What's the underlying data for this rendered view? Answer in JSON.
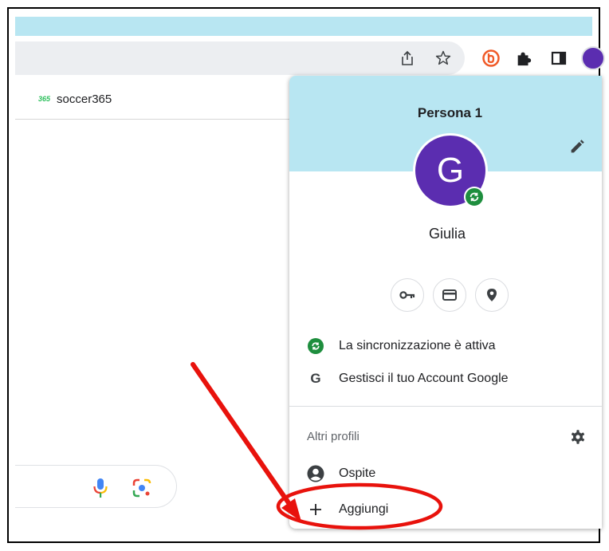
{
  "bookmarks": {
    "items": [
      {
        "label": "soccer365",
        "favicon_text": "365"
      }
    ]
  },
  "profile_menu": {
    "title": "Persona 1",
    "avatar_letter": "G",
    "name": "Giulia",
    "sync_label": "La sincronizzazione è attiva",
    "manage_account_label": "Gestisci il tuo Account Google",
    "other_profiles_label": "Altri profili",
    "guest_label": "Ospite",
    "add_label": "Aggiungi"
  },
  "icons": {
    "toolbar": [
      "share-icon",
      "bookmark-star-icon",
      "extension-b-icon",
      "extensions-puzzle-icon",
      "side-panel-icon",
      "profile-avatar-icon"
    ],
    "quick_actions": [
      "passwords-key-icon",
      "payment-card-icon",
      "addresses-pin-icon"
    ]
  },
  "colors": {
    "header_bg": "#b8e6f2",
    "avatar_bg": "#5b2db0",
    "sync_green": "#1e8e3e",
    "annotation_red": "#e8120c"
  }
}
